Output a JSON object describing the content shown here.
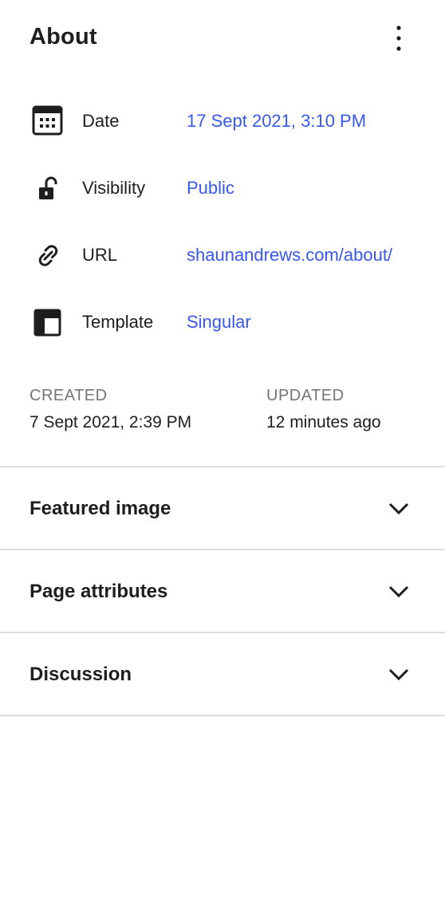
{
  "panel": {
    "title": "About"
  },
  "info_rows": [
    {
      "label": "Date",
      "value": "17 Sept 2021, 3:10 PM",
      "icon": "calendar-icon"
    },
    {
      "label": "Visibility",
      "value": "Public",
      "icon": "unlock-icon"
    },
    {
      "label": "URL",
      "value": "shaunandrews.com/about/",
      "icon": "link-icon"
    },
    {
      "label": "Template",
      "value": "Singular",
      "icon": "layout-icon"
    }
  ],
  "meta": {
    "created_label": "CREATED",
    "created_value": "7 Sept 2021, 2:39 PM",
    "updated_label": "UPDATED",
    "updated_value": "12 minutes ago"
  },
  "sections": [
    {
      "title": "Featured image"
    },
    {
      "title": "Page attributes"
    },
    {
      "title": "Discussion"
    }
  ],
  "colors": {
    "link": "#3858e9",
    "text": "#1e1e1e",
    "muted": "#757575",
    "divider": "#dddddd"
  }
}
